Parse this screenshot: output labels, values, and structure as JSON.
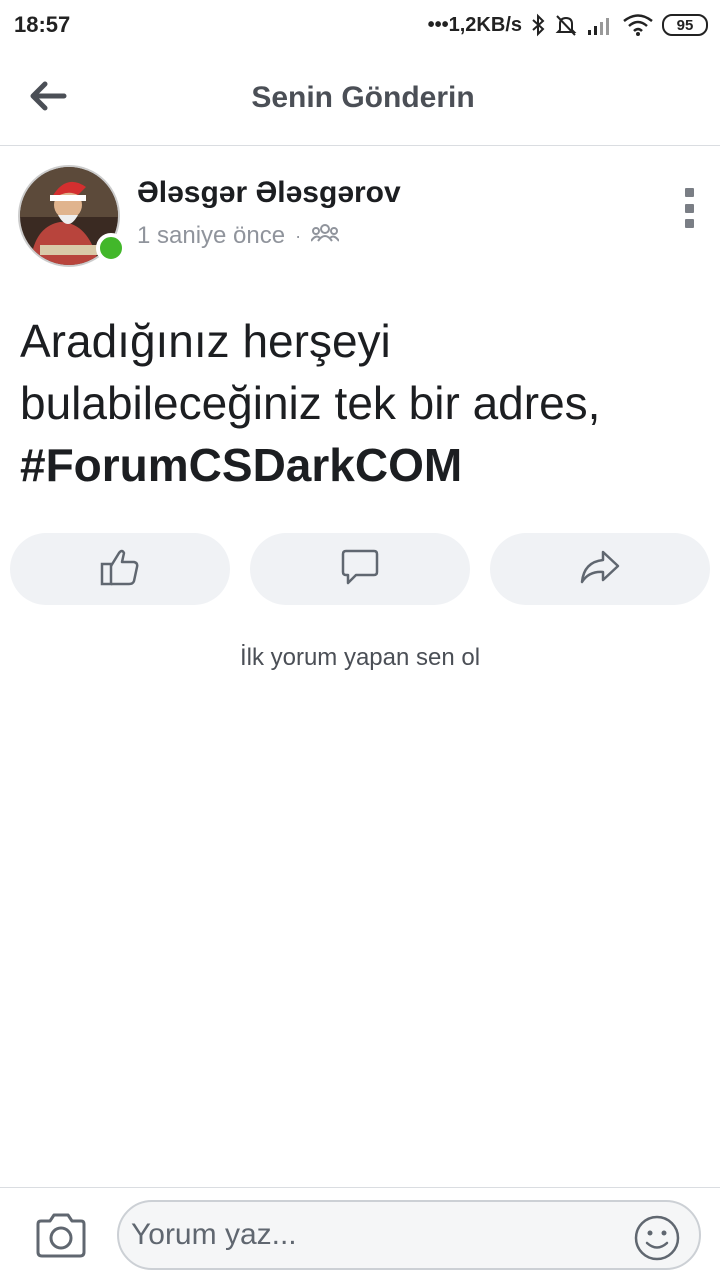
{
  "status_bar": {
    "time": "18:57",
    "network_speed": "•••1,2KB/s",
    "battery_level": "95",
    "icons": [
      "bluetooth-icon",
      "mute-icon",
      "signal-icon",
      "wifi-icon",
      "battery-icon"
    ]
  },
  "header": {
    "title": "Senin Gönderin",
    "back_icon": "arrow-left-icon"
  },
  "post": {
    "author": "Ələsgər Ələsgərov",
    "time": "1 saniye önce",
    "separator": "·",
    "audience_icon": "friends-icon",
    "online": true,
    "text_lines": [
      "Aradığınız herşeyi",
      "bulabileceğiniz tek bir adres,"
    ],
    "hashtag": "#ForumCSDarkCOM"
  },
  "actions": {
    "icons": [
      "like-icon",
      "comment-icon",
      "share-icon"
    ]
  },
  "comments": {
    "empty_text": "İlk yorum yapan sen ol"
  },
  "compose": {
    "placeholder": "Yorum yaz...",
    "camera_icon": "camera-icon",
    "emoji_icon": "emoji-icon"
  },
  "colors": {
    "accent_online": "#42b72a",
    "button_bg": "#f0f2f5",
    "muted_text": "#90949c",
    "header_text": "#4b4f56"
  }
}
